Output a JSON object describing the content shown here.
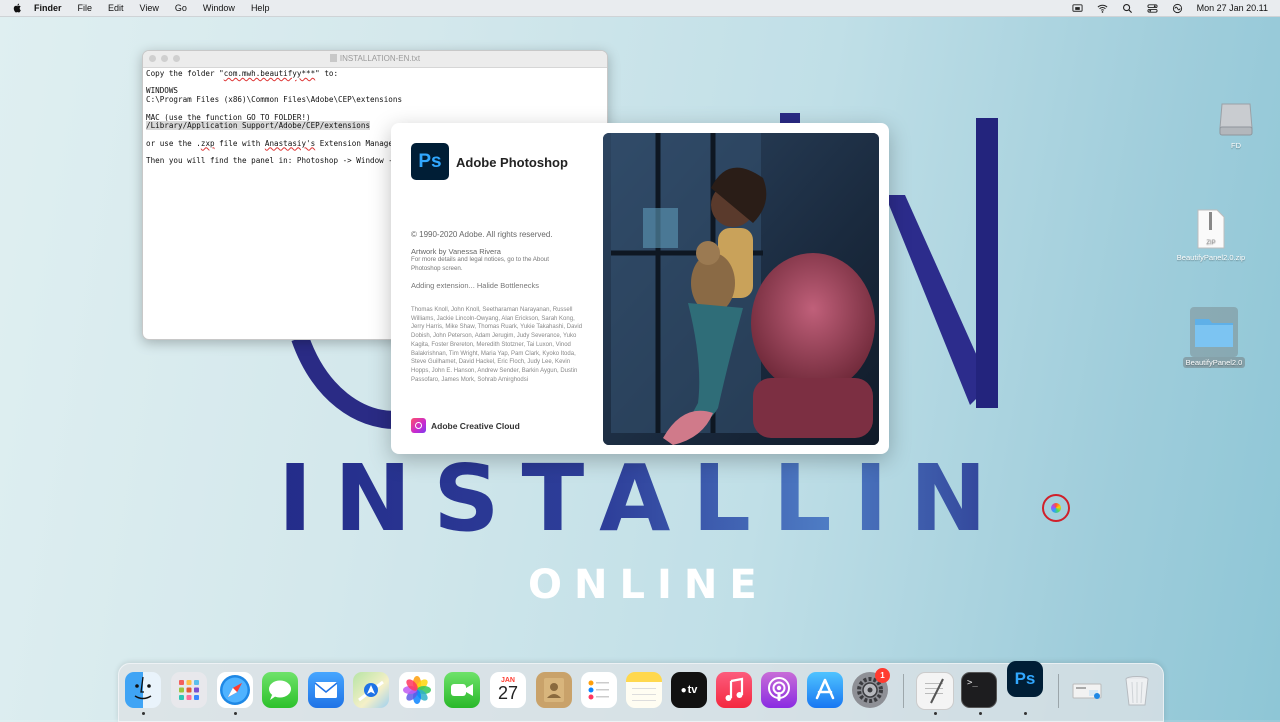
{
  "menubar": {
    "app_name": "Finder",
    "items": [
      "File",
      "Edit",
      "View",
      "Go",
      "Window",
      "Help"
    ],
    "datetime": "Mon 27 Jan  20.11"
  },
  "background": {
    "big_word": "INSTALLIN",
    "sub_word": "ONLINE"
  },
  "editor": {
    "title": "INSTALLATION-EN.txt",
    "lines": {
      "l1a": "Copy the folder \"",
      "l1b": "com.mwh.beautifyy***",
      "l1c": "\" to:",
      "l2": "WINDOWS",
      "l3": "C:\\Program Files (x86)\\Common Files\\Adobe\\CEP\\extensions",
      "l4": "MAC (use the function GO TO FOLDER!)",
      "l5": "/Library/Application Support/Adobe/CEP/extensions",
      "l6a": "or use the .",
      "l6b": "zxp",
      "l6c": " file with ",
      "l6d": "Anastasiy's",
      "l6e": " Extension Manager",
      "l7": "Then you will find the panel in: Photoshop -> Window ->"
    }
  },
  "splash": {
    "logo_text": "Ps",
    "title": "Adobe Photoshop",
    "copyright": "© 1990-2020 Adobe. All rights reserved.",
    "artwork": "Artwork by Vanessa Rivera",
    "legal": "For more details and legal notices, go to the About Photoshop screen.",
    "status": "Adding extension... Halide Bottlenecks",
    "credits": "Thomas Knoll, John Knoll, Seetharaman Narayanan, Russell Williams, Jackie Lincoln-Owyang, Alan Erickson, Sarah Kong, Jerry Harris, Mike Shaw, Thomas Ruark, Yukie Takahashi, David Dobish, John Peterson, Adam Jerugim, Judy Severance, Yuko Kagita, Foster Brereton, Meredith Stotzner, Tai Luxon, Vinod Balakrishnan, Tim Wright, Maria Yap, Pam Clark, Kyoko Itoda, Steve Guilhamet, David Hackel, Eric Floch, Judy Lee, Kevin Hopps, John E. Hanson, Andrew Sender, Barkin Aygun, Dustin Passofaro, James Mork, Sohrab Amirghodsi",
    "cc_label": "Adobe Creative Cloud"
  },
  "desktop": {
    "icons": [
      {
        "label": "FD",
        "kind": "drive-icon"
      },
      {
        "label": "BeautifyPanel2.0.zip",
        "kind": "zip-icon",
        "badge": "ZIP"
      },
      {
        "label": "BeautifyPanel2.0",
        "kind": "folder-icon"
      }
    ]
  },
  "dock": {
    "calendar_month": "JAN",
    "calendar_day": "27",
    "settings_badge": "1",
    "tv_label": "tv",
    "ps_label": "Ps",
    "terminal_prompt": ">_"
  },
  "colors": {
    "ps_dark": "#001e36",
    "ps_blue": "#31a8ff",
    "installin_start": "#242c8a",
    "installin_end": "#4e7cc4"
  }
}
